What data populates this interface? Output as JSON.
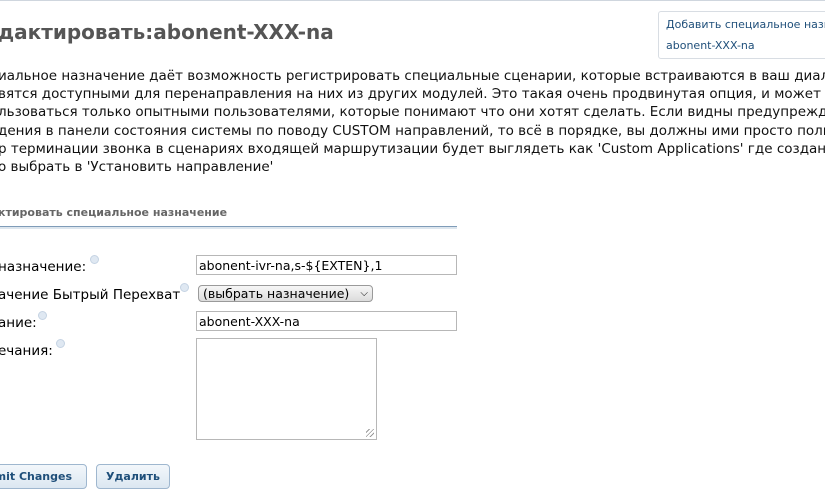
{
  "page": {
    "title": "дактировать:abonent-XXX-na"
  },
  "side_panel": {
    "add_link": "Добавить специальное назначе",
    "item_link": "abonent-XXX-na"
  },
  "description": {
    "lines": [
      "иальное назначение даёт возможность регистрировать специальные сценарии, которые встраиваются в ваш диал план и",
      "вятся доступными для перенаправления на них из других модулей. Это такая очень продвинутая опция, и может",
      "льзоваться только опытными пользователями, которые понимают что они хотят сделать. Если видны предупреждения ил",
      "дения в панели состояния системы по поводу CUSTOM направлений, то всё в порядке, вы должны ими просто пользоват",
      "р терминации звонка в сценариях входящей маршрутизации будет выглядеть как 'Custom Applications' где созданный конт",
      "о выбрать в 'Установить направление'"
    ]
  },
  "form": {
    "section_title": "ктировать специальное назначение",
    "destination": {
      "label": "назначение:",
      "value": "abonent-ivr-na,s-${EXTEN},1"
    },
    "failover": {
      "label": "ачение Бытрый Перехват",
      "selected": "(выбрать назначение)"
    },
    "description": {
      "label": "ание:",
      "value": "abonent-XXX-na"
    },
    "notes": {
      "label": "ечания:",
      "value": ""
    }
  },
  "buttons": {
    "submit": "mit Changes",
    "delete": "Удалить"
  }
}
